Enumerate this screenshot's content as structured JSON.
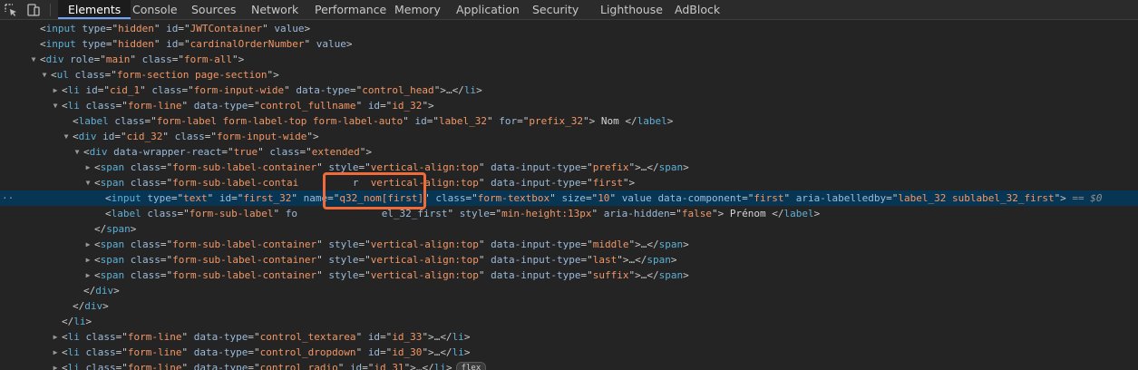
{
  "tabs": [
    {
      "label": "Elements",
      "active": true
    },
    {
      "label": "Console"
    },
    {
      "label": "Sources"
    },
    {
      "label": "Network"
    },
    {
      "label": "Performance"
    },
    {
      "label": "Memory"
    },
    {
      "label": "Application"
    },
    {
      "label": "Security"
    },
    {
      "label": "Lighthouse"
    },
    {
      "label": "AdBlock"
    }
  ],
  "icons": {
    "inspect": "inspect-element-icon",
    "device": "device-toggle-icon"
  },
  "colors": {
    "highlight": "#f06b3a",
    "selected_row": "#073655",
    "tag": "#5db0d7",
    "attr": "#9bbbdc",
    "value": "#f29766"
  },
  "selection_marker": "== $0",
  "flex_badge": "flex",
  "lines": [
    {
      "tokens": [
        [
          "p",
          "<"
        ],
        [
          "t",
          "input"
        ],
        [
          "p",
          " "
        ],
        [
          "a",
          "type"
        ],
        [
          "p",
          "=\""
        ],
        [
          "v",
          "hidden"
        ],
        [
          "p",
          "\" "
        ],
        [
          "a",
          "id"
        ],
        [
          "p",
          "=\""
        ],
        [
          "v",
          "JWTContainer"
        ],
        [
          "p",
          "\" "
        ],
        [
          "a",
          "value"
        ],
        [
          "p",
          ">"
        ]
      ]
    },
    {
      "tokens": [
        [
          "p",
          "<"
        ],
        [
          "t",
          "input"
        ],
        [
          "p",
          " "
        ],
        [
          "a",
          "type"
        ],
        [
          "p",
          "=\""
        ],
        [
          "v",
          "hidden"
        ],
        [
          "p",
          "\" "
        ],
        [
          "a",
          "id"
        ],
        [
          "p",
          "=\""
        ],
        [
          "v",
          "cardinalOrderNumber"
        ],
        [
          "p",
          "\" "
        ],
        [
          "a",
          "value"
        ],
        [
          "p",
          ">"
        ]
      ]
    },
    {
      "tokens": [
        [
          "p",
          "<"
        ],
        [
          "t",
          "div"
        ],
        [
          "p",
          " "
        ],
        [
          "a",
          "role"
        ],
        [
          "p",
          "=\""
        ],
        [
          "v",
          "main"
        ],
        [
          "p",
          "\" "
        ],
        [
          "a",
          "class"
        ],
        [
          "p",
          "=\""
        ],
        [
          "v",
          "form-all"
        ],
        [
          "p",
          "\">"
        ]
      ]
    },
    {
      "tokens": [
        [
          "p",
          "<"
        ],
        [
          "t",
          "ul"
        ],
        [
          "p",
          " "
        ],
        [
          "a",
          "class"
        ],
        [
          "p",
          "=\""
        ],
        [
          "v",
          "form-section page-section"
        ],
        [
          "p",
          "\">"
        ]
      ]
    },
    {
      "tokens": [
        [
          "p",
          "<"
        ],
        [
          "t",
          "li"
        ],
        [
          "p",
          " "
        ],
        [
          "a",
          "id"
        ],
        [
          "p",
          "=\""
        ],
        [
          "v",
          "cid_1"
        ],
        [
          "p",
          "\" "
        ],
        [
          "a",
          "class"
        ],
        [
          "p",
          "=\""
        ],
        [
          "v",
          "form-input-wide"
        ],
        [
          "p",
          "\" "
        ],
        [
          "a",
          "data-type"
        ],
        [
          "p",
          "=\""
        ],
        [
          "v",
          "control_head"
        ],
        [
          "p",
          "\">"
        ],
        [
          "el",
          "…"
        ],
        [
          "p",
          "</"
        ],
        [
          "t",
          "li"
        ],
        [
          "p",
          ">"
        ]
      ]
    },
    {
      "tokens": [
        [
          "p",
          "<"
        ],
        [
          "t",
          "li"
        ],
        [
          "p",
          " "
        ],
        [
          "a",
          "class"
        ],
        [
          "p",
          "=\""
        ],
        [
          "v",
          "form-line"
        ],
        [
          "p",
          "\" "
        ],
        [
          "a",
          "data-type"
        ],
        [
          "p",
          "=\""
        ],
        [
          "v",
          "control_fullname"
        ],
        [
          "p",
          "\" "
        ],
        [
          "a",
          "id"
        ],
        [
          "p",
          "=\""
        ],
        [
          "v",
          "id_32"
        ],
        [
          "p",
          "\">"
        ]
      ]
    },
    {
      "tokens": [
        [
          "p",
          "<"
        ],
        [
          "t",
          "label"
        ],
        [
          "p",
          " "
        ],
        [
          "a",
          "class"
        ],
        [
          "p",
          "=\""
        ],
        [
          "v",
          "form-label form-label-top form-label-auto"
        ],
        [
          "p",
          "\" "
        ],
        [
          "a",
          "id"
        ],
        [
          "p",
          "=\""
        ],
        [
          "v",
          "label_32"
        ],
        [
          "p",
          "\" "
        ],
        [
          "a",
          "for"
        ],
        [
          "p",
          "=\""
        ],
        [
          "v",
          "prefix_32"
        ],
        [
          "p",
          "\">"
        ],
        [
          "x",
          " Nom "
        ],
        [
          "p",
          "</"
        ],
        [
          "t",
          "label"
        ],
        [
          "p",
          ">"
        ]
      ]
    },
    {
      "tokens": [
        [
          "p",
          "<"
        ],
        [
          "t",
          "div"
        ],
        [
          "p",
          " "
        ],
        [
          "a",
          "id"
        ],
        [
          "p",
          "=\""
        ],
        [
          "v",
          "cid_32"
        ],
        [
          "p",
          "\" "
        ],
        [
          "a",
          "class"
        ],
        [
          "p",
          "=\""
        ],
        [
          "v",
          "form-input-wide"
        ],
        [
          "p",
          "\">"
        ]
      ]
    },
    {
      "tokens": [
        [
          "p",
          "<"
        ],
        [
          "t",
          "div"
        ],
        [
          "p",
          " "
        ],
        [
          "a",
          "data-wrapper-react"
        ],
        [
          "p",
          "=\""
        ],
        [
          "v",
          "true"
        ],
        [
          "p",
          "\" "
        ],
        [
          "a",
          "class"
        ],
        [
          "p",
          "=\""
        ],
        [
          "v",
          "extended"
        ],
        [
          "p",
          "\">"
        ]
      ]
    },
    {
      "tokens": [
        [
          "p",
          "<"
        ],
        [
          "t",
          "span"
        ],
        [
          "p",
          " "
        ],
        [
          "a",
          "class"
        ],
        [
          "p",
          "=\""
        ],
        [
          "v",
          "form-sub-label-container"
        ],
        [
          "p",
          "\" "
        ],
        [
          "a",
          "style"
        ],
        [
          "p",
          "=\""
        ],
        [
          "v",
          "vertical-align:top"
        ],
        [
          "p",
          "\" "
        ],
        [
          "a",
          "data-input-type"
        ],
        [
          "p",
          "=\""
        ],
        [
          "v",
          "prefix"
        ],
        [
          "p",
          "\">"
        ],
        [
          "el",
          "…"
        ],
        [
          "p",
          "</"
        ],
        [
          "t",
          "span"
        ],
        [
          "p",
          ">"
        ]
      ]
    },
    {
      "tokens": [
        [
          "p",
          "<"
        ],
        [
          "t",
          "span"
        ],
        [
          "p",
          " "
        ],
        [
          "a",
          "class"
        ],
        [
          "p",
          "=\""
        ],
        [
          "v",
          "form-sub-label-contai"
        ],
        [
          "p",
          "         "
        ],
        [
          "a",
          "r"
        ],
        [
          "p",
          "  "
        ],
        [
          "v",
          "vertical-align:top"
        ],
        [
          "p",
          "\" "
        ],
        [
          "a",
          "data-input-type"
        ],
        [
          "p",
          "=\""
        ],
        [
          "v",
          "first"
        ],
        [
          "p",
          "\">"
        ]
      ]
    },
    {
      "tokens": [
        [
          "p",
          "<"
        ],
        [
          "t",
          "input"
        ],
        [
          "p",
          " "
        ],
        [
          "a",
          "type"
        ],
        [
          "p",
          "=\""
        ],
        [
          "v",
          "text"
        ],
        [
          "p",
          "\" "
        ],
        [
          "a",
          "id"
        ],
        [
          "p",
          "=\""
        ],
        [
          "v",
          "first_32"
        ],
        [
          "p",
          "\" "
        ],
        [
          "a",
          "name"
        ],
        [
          "p",
          "=\""
        ],
        [
          "v",
          "q32_nom[first]"
        ],
        [
          "p",
          "\" "
        ],
        [
          "a",
          "class"
        ],
        [
          "p",
          "=\""
        ],
        [
          "v",
          "form-textbox"
        ],
        [
          "p",
          "\" "
        ],
        [
          "a",
          "size"
        ],
        [
          "p",
          "=\""
        ],
        [
          "v",
          "10"
        ],
        [
          "p",
          "\" "
        ],
        [
          "a",
          "value"
        ],
        [
          "p",
          " "
        ],
        [
          "a",
          "data-component"
        ],
        [
          "p",
          "=\""
        ],
        [
          "v",
          "first"
        ],
        [
          "p",
          "\" "
        ],
        [
          "a",
          "aria-labelledby"
        ],
        [
          "p",
          "=\""
        ],
        [
          "v",
          "label_32 sublabel_32_first"
        ],
        [
          "p",
          "\">"
        ]
      ]
    },
    {
      "tokens": [
        [
          "p",
          "<"
        ],
        [
          "t",
          "label"
        ],
        [
          "p",
          " "
        ],
        [
          "a",
          "class"
        ],
        [
          "p",
          "=\""
        ],
        [
          "v",
          "form-sub-label"
        ],
        [
          "p",
          "\" "
        ],
        [
          "a",
          "fo"
        ],
        [
          "p",
          "              "
        ],
        [
          "a",
          "el_32_first"
        ],
        [
          "p",
          "\" "
        ],
        [
          "a",
          "style"
        ],
        [
          "p",
          "=\""
        ],
        [
          "v",
          "min-height:13px"
        ],
        [
          "p",
          "\" "
        ],
        [
          "a",
          "aria-hidden"
        ],
        [
          "p",
          "=\""
        ],
        [
          "v",
          "false"
        ],
        [
          "p",
          "\">"
        ],
        [
          "x",
          " Prénom "
        ],
        [
          "p",
          "</"
        ],
        [
          "t",
          "label"
        ],
        [
          "p",
          ">"
        ]
      ]
    },
    {
      "tokens": [
        [
          "p",
          "</"
        ],
        [
          "t",
          "span"
        ],
        [
          "p",
          ">"
        ]
      ]
    },
    {
      "tokens": [
        [
          "p",
          "<"
        ],
        [
          "t",
          "span"
        ],
        [
          "p",
          " "
        ],
        [
          "a",
          "class"
        ],
        [
          "p",
          "=\""
        ],
        [
          "v",
          "form-sub-label-container"
        ],
        [
          "p",
          "\" "
        ],
        [
          "a",
          "style"
        ],
        [
          "p",
          "=\""
        ],
        [
          "v",
          "vertical-align:top"
        ],
        [
          "p",
          "\" "
        ],
        [
          "a",
          "data-input-type"
        ],
        [
          "p",
          "=\""
        ],
        [
          "v",
          "middle"
        ],
        [
          "p",
          "\">"
        ],
        [
          "el",
          "…"
        ],
        [
          "p",
          "</"
        ],
        [
          "t",
          "span"
        ],
        [
          "p",
          ">"
        ]
      ]
    },
    {
      "tokens": [
        [
          "p",
          "<"
        ],
        [
          "t",
          "span"
        ],
        [
          "p",
          " "
        ],
        [
          "a",
          "class"
        ],
        [
          "p",
          "=\""
        ],
        [
          "v",
          "form-sub-label-container"
        ],
        [
          "p",
          "\" "
        ],
        [
          "a",
          "style"
        ],
        [
          "p",
          "=\""
        ],
        [
          "v",
          "vertical-align:top"
        ],
        [
          "p",
          "\" "
        ],
        [
          "a",
          "data-input-type"
        ],
        [
          "p",
          "=\""
        ],
        [
          "v",
          "last"
        ],
        [
          "p",
          "\">"
        ],
        [
          "el",
          "…"
        ],
        [
          "p",
          "</"
        ],
        [
          "t",
          "span"
        ],
        [
          "p",
          ">"
        ]
      ]
    },
    {
      "tokens": [
        [
          "p",
          "<"
        ],
        [
          "t",
          "span"
        ],
        [
          "p",
          " "
        ],
        [
          "a",
          "class"
        ],
        [
          "p",
          "=\""
        ],
        [
          "v",
          "form-sub-label-container"
        ],
        [
          "p",
          "\" "
        ],
        [
          "a",
          "style"
        ],
        [
          "p",
          "=\""
        ],
        [
          "v",
          "vertical-align:top"
        ],
        [
          "p",
          "\" "
        ],
        [
          "a",
          "data-input-type"
        ],
        [
          "p",
          "=\""
        ],
        [
          "v",
          "suffix"
        ],
        [
          "p",
          "\">"
        ],
        [
          "el",
          "…"
        ],
        [
          "p",
          "</"
        ],
        [
          "t",
          "span"
        ],
        [
          "p",
          ">"
        ]
      ]
    },
    {
      "tokens": [
        [
          "p",
          "</"
        ],
        [
          "t",
          "div"
        ],
        [
          "p",
          ">"
        ]
      ]
    },
    {
      "tokens": [
        [
          "p",
          "</"
        ],
        [
          "t",
          "div"
        ],
        [
          "p",
          ">"
        ]
      ]
    },
    {
      "tokens": [
        [
          "p",
          "</"
        ],
        [
          "t",
          "li"
        ],
        [
          "p",
          ">"
        ]
      ]
    },
    {
      "tokens": [
        [
          "p",
          "<"
        ],
        [
          "t",
          "li"
        ],
        [
          "p",
          " "
        ],
        [
          "a",
          "class"
        ],
        [
          "p",
          "=\""
        ],
        [
          "v",
          "form-line"
        ],
        [
          "p",
          "\" "
        ],
        [
          "a",
          "data-type"
        ],
        [
          "p",
          "=\""
        ],
        [
          "v",
          "control_textarea"
        ],
        [
          "p",
          "\" "
        ],
        [
          "a",
          "id"
        ],
        [
          "p",
          "=\""
        ],
        [
          "v",
          "id_33"
        ],
        [
          "p",
          "\">"
        ],
        [
          "el",
          "…"
        ],
        [
          "p",
          "</"
        ],
        [
          "t",
          "li"
        ],
        [
          "p",
          ">"
        ]
      ]
    },
    {
      "tokens": [
        [
          "p",
          "<"
        ],
        [
          "t",
          "li"
        ],
        [
          "p",
          " "
        ],
        [
          "a",
          "class"
        ],
        [
          "p",
          "=\""
        ],
        [
          "v",
          "form-line"
        ],
        [
          "p",
          "\" "
        ],
        [
          "a",
          "data-type"
        ],
        [
          "p",
          "=\""
        ],
        [
          "v",
          "control_dropdown"
        ],
        [
          "p",
          "\" "
        ],
        [
          "a",
          "id"
        ],
        [
          "p",
          "=\""
        ],
        [
          "v",
          "id_30"
        ],
        [
          "p",
          "\">"
        ],
        [
          "el",
          "…"
        ],
        [
          "p",
          "</"
        ],
        [
          "t",
          "li"
        ],
        [
          "p",
          ">"
        ]
      ]
    },
    {
      "tokens": [
        [
          "p",
          "<"
        ],
        [
          "t",
          "li"
        ],
        [
          "p",
          " "
        ],
        [
          "a",
          "class"
        ],
        [
          "p",
          "=\""
        ],
        [
          "v",
          "form-line"
        ],
        [
          "p",
          "\" "
        ],
        [
          "a",
          "data-type"
        ],
        [
          "p",
          "=\""
        ],
        [
          "v",
          "control_radio"
        ],
        [
          "p",
          "\" "
        ],
        [
          "a",
          "id"
        ],
        [
          "p",
          "=\""
        ],
        [
          "v",
          "id_31"
        ],
        [
          "p",
          "\">"
        ],
        [
          "el",
          "…"
        ],
        [
          "p",
          "</"
        ],
        [
          "t",
          "li"
        ],
        [
          "p",
          ">"
        ]
      ]
    }
  ]
}
